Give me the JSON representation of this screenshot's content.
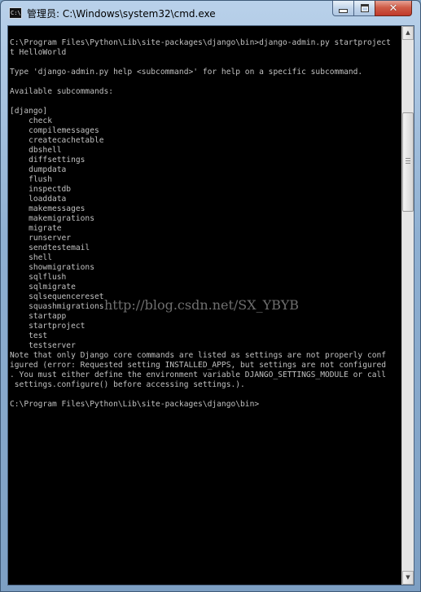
{
  "window": {
    "title": "管理员: C:\\Windows\\system32\\cmd.exe",
    "icon_label": "C:\\"
  },
  "controls": {
    "minimize": "minimize-icon",
    "maximize": "maximize-icon",
    "close": "close-icon"
  },
  "console": {
    "lines": [
      "C:\\Program Files\\Python\\Lib\\site-packages\\django\\bin>django-admin.py startproject",
      "t HelloWorld",
      "",
      "Type 'django-admin.py help <subcommand>' for help on a specific subcommand.",
      "",
      "Available subcommands:",
      "",
      "[django]",
      "    check",
      "    compilemessages",
      "    createcachetable",
      "    dbshell",
      "    diffsettings",
      "    dumpdata",
      "    flush",
      "    inspectdb",
      "    loaddata",
      "    makemessages",
      "    makemigrations",
      "    migrate",
      "    runserver",
      "    sendtestemail",
      "    shell",
      "    showmigrations",
      "    sqlflush",
      "    sqlmigrate",
      "    sqlsequencereset",
      "    squashmigrations",
      "    startapp",
      "    startproject",
      "    test",
      "    testserver",
      "Note that only Django core commands are listed as settings are not properly conf",
      "igured (error: Requested setting INSTALLED_APPS, but settings are not configured",
      ". You must either define the environment variable DJANGO_SETTINGS_MODULE or call",
      " settings.configure() before accessing settings.).",
      "",
      "C:\\Program Files\\Python\\Lib\\site-packages\\django\\bin>"
    ],
    "watermark": "http://blog.csdn.net/SX_YBYB"
  },
  "colors": {
    "console_bg": "#000000",
    "console_fg": "#c0c0c0",
    "close_button": "#c0392b"
  }
}
